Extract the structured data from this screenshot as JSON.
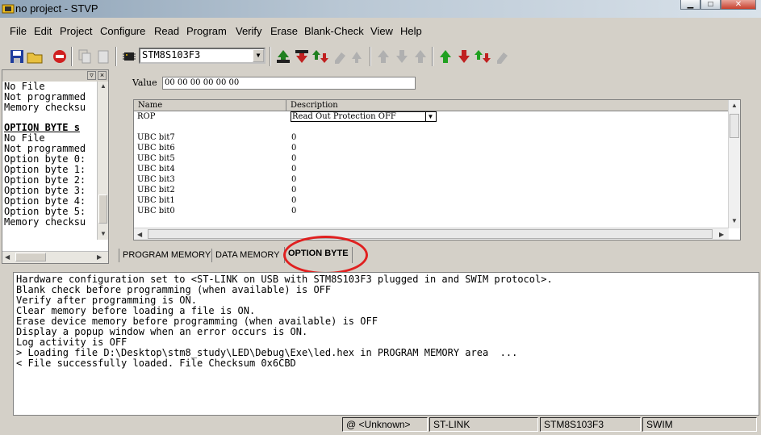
{
  "window": {
    "title": "no project - STVP"
  },
  "menu": [
    {
      "label": "File"
    },
    {
      "label": "Edit"
    },
    {
      "label": "Project"
    },
    {
      "label": "Configure"
    },
    {
      "label": "Read"
    },
    {
      "label": "Program"
    },
    {
      "label": "Verify"
    },
    {
      "label": "Erase"
    },
    {
      "label": "Blank-Check"
    },
    {
      "label": "View"
    },
    {
      "label": "Help"
    }
  ],
  "toolbar": {
    "device": "STM8S103F3"
  },
  "left_panel": {
    "lines": [
      "No File",
      "Not programmed",
      "Memory checksu"
    ],
    "option_header": "OPTION BYTE s",
    "option_lines": [
      "No File",
      "Not programmed",
      "Option byte 0:",
      "Option byte 1:",
      "Option byte 2:",
      "Option byte 3:",
      "Option byte 4:",
      "Option byte 5:",
      "Memory checksu"
    ]
  },
  "option_byte": {
    "value_label": "Value",
    "value": "00 00 00 00 00 00",
    "columns": [
      "Name",
      "Description"
    ],
    "rop": {
      "name": "ROP",
      "description": "Read Out Protection OFF"
    },
    "rows": [
      {
        "name": "UBC bit7",
        "value": "0"
      },
      {
        "name": "UBC bit6",
        "value": "0"
      },
      {
        "name": "UBC bit5",
        "value": "0"
      },
      {
        "name": "UBC bit4",
        "value": "0"
      },
      {
        "name": "UBC bit3",
        "value": "0"
      },
      {
        "name": "UBC bit2",
        "value": "0"
      },
      {
        "name": "UBC bit1",
        "value": "0"
      },
      {
        "name": "UBC bit0",
        "value": "0"
      }
    ]
  },
  "tabs": [
    {
      "label": "PROGRAM MEMORY"
    },
    {
      "label": "DATA MEMORY"
    },
    {
      "label": "OPTION BYTE"
    }
  ],
  "log": [
    "Hardware configuration set to <ST-LINK on USB with STM8S103F3 plugged in and SWIM protocol>.",
    "Blank check before programming (when available) is OFF",
    "Verify after programming is ON.",
    "Clear memory before loading a file is ON.",
    "Erase device memory before programming (when available) is OFF",
    "Display a popup window when an error occurs is ON.",
    "Log activity is OFF",
    "> Loading file D:\\Desktop\\stm8_study\\LED\\Debug\\Exe\\led.hex in PROGRAM MEMORY area  ...",
    "< File successfully loaded. File Checksum 0x6CBD"
  ],
  "status": {
    "address": "@ <Unknown>",
    "tool": "ST-LINK",
    "device": "STM8S103F3",
    "protocol": "SWIM"
  },
  "colors": {
    "highlight_circle": "#e02020"
  }
}
